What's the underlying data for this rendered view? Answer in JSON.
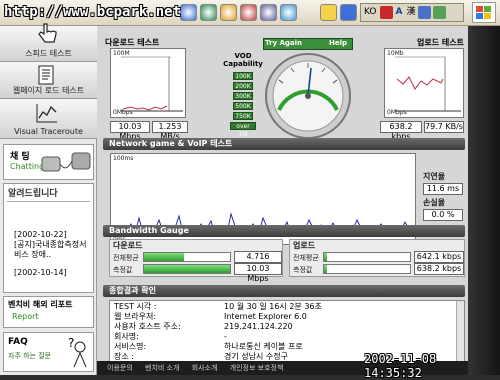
{
  "watermark": "http://www.bcpark.net",
  "timestamp": "2002-11-08 14:35:32",
  "langbar": {
    "lang": "KO",
    "a_icon": "A",
    "hanja": "漢"
  },
  "sidebar": {
    "nav": [
      {
        "label": "스피드 테스트",
        "icon": "hand-pointer-icon"
      },
      {
        "label": "웹페이지 로드 테스트",
        "icon": "document-icon"
      },
      {
        "label": "Visual Traceroute",
        "icon": "graph-icon"
      }
    ],
    "chatting": {
      "title": "채 팅",
      "sub": "Chatting"
    },
    "notice": {
      "title": "알려드립니다",
      "items": [
        "[2002-10-22]",
        "[공지]국내종합측정서비스 장애..",
        "[2002-10-14]"
      ]
    },
    "report": {
      "title": "벤치비 해외 리포트",
      "sub": "Report"
    },
    "faq": {
      "title": "FAQ",
      "sub": "자주 하는 질문"
    }
  },
  "download_panel": {
    "title": "다운로드 테스트",
    "top_label": "100M",
    "bottom_label": "0Mbps",
    "mbps": "10.03 Mbps",
    "mbs": "1.253 MB/s"
  },
  "upload_panel": {
    "title": "업로드 테스트",
    "top_label": "10Mb",
    "bottom_label": "0Mbps",
    "kbps": "638.2 kbps",
    "kbs": "79.7 KB/s"
  },
  "vod": {
    "title": "VOD Capability",
    "levels": [
      "100K",
      "200K",
      "300K",
      "500K",
      "750K",
      "over 1M"
    ]
  },
  "gauge": {
    "try_again": "Try Again",
    "help": "Help"
  },
  "network": {
    "title": "Network game & VoIP 테스트",
    "top_label": "100ms",
    "bottom_label": "0ms",
    "latency_label": "지연율",
    "latency": "11.6 ms",
    "loss_label": "손실율",
    "loss": "0.0 %"
  },
  "bandwidth": {
    "title": "Bandwidth Gauge",
    "download": {
      "title": "다운로드",
      "rows": [
        {
          "label": "전체평균",
          "value": "4.716 Mbps",
          "fill": 0.47
        },
        {
          "label": "측정값",
          "value": "10.03 Mbps",
          "fill": 1.0
        }
      ]
    },
    "upload": {
      "title": "업로드",
      "rows": [
        {
          "label": "전체평균",
          "value": "642.1 kbps",
          "fill": 0.04
        },
        {
          "label": "측정값",
          "value": "638.2 kbps",
          "fill": 0.04
        }
      ]
    }
  },
  "summary": {
    "title": "종합결과 확인",
    "rows": [
      {
        "k": "TEST 시각 :",
        "v": "10 월 30 일  16시 2분 36초"
      },
      {
        "k": "웹 브라우저:",
        "v": "Internet Explorer 6.0"
      },
      {
        "k": "사용자 호스트 주소:",
        "v": "219.241.124.220"
      },
      {
        "k": "회사명:",
        "v": "-"
      },
      {
        "k": "서비스명:",
        "v": "하나로통신 케이블 프로"
      },
      {
        "k": "장소 :",
        "v": "경기 성남시 수정구"
      }
    ]
  },
  "footer": [
    "이용문의",
    "벤치비 소개",
    "회사소개",
    "개인정보 보호정책"
  ],
  "colors": {
    "accent_green": "#2f9e2f",
    "graph_line": "#1a1aa0",
    "header_bg": "#4a4a4a"
  }
}
